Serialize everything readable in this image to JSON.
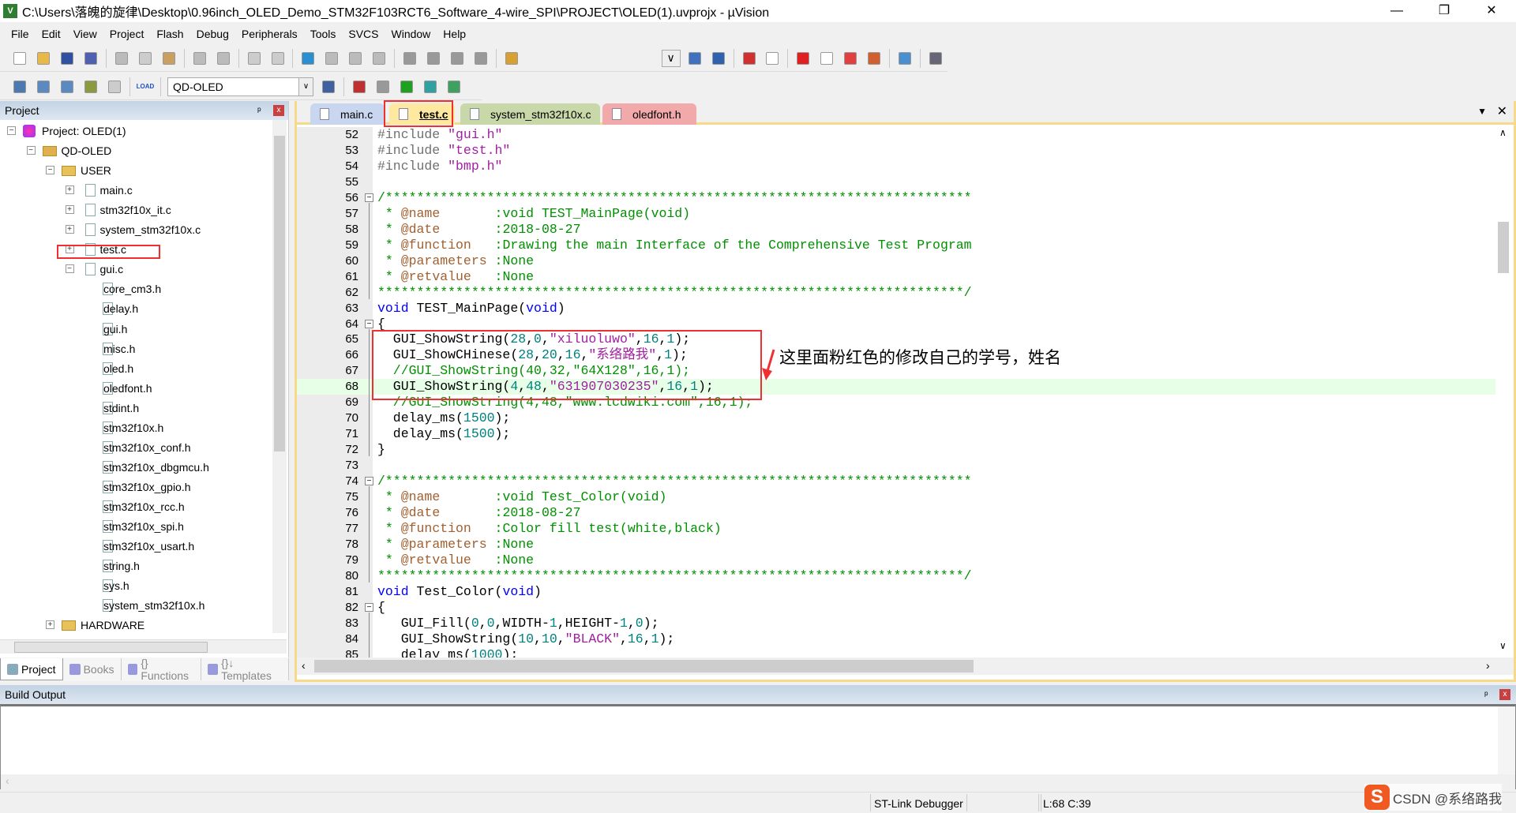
{
  "window": {
    "title": "C:\\Users\\落魄的旋律\\Desktop\\0.96inch_OLED_Demo_STM32F103RCT6_Software_4-wire_SPI\\PROJECT\\OLED(1).uvprojx - µVision",
    "minimize": "—",
    "restore": "❐",
    "close": "✕"
  },
  "menu": [
    "File",
    "Edit",
    "View",
    "Project",
    "Flash",
    "Debug",
    "Peripherals",
    "Tools",
    "SVCS",
    "Window",
    "Help"
  ],
  "toolbar": {
    "target": "QD-OLED",
    "load_label": "LOAD"
  },
  "project_panel": {
    "title": "Project",
    "pin": "ᵖ",
    "close": "x",
    "tree": [
      {
        "label": "Project: OLED(1)",
        "level": 0,
        "type": "project",
        "exp": "−"
      },
      {
        "label": "QD-OLED",
        "level": 1,
        "type": "target",
        "exp": "−"
      },
      {
        "label": "USER",
        "level": 2,
        "type": "folder",
        "exp": "−"
      },
      {
        "label": "main.c",
        "level": 3,
        "type": "file",
        "exp": "+"
      },
      {
        "label": "stm32f10x_it.c",
        "level": 3,
        "type": "file",
        "exp": "+"
      },
      {
        "label": "system_stm32f10x.c",
        "level": 3,
        "type": "file",
        "exp": "+"
      },
      {
        "label": "test.c",
        "level": 3,
        "type": "file",
        "exp": "+"
      },
      {
        "label": "gui.c",
        "level": 3,
        "type": "file",
        "exp": "−"
      },
      {
        "label": "core_cm3.h",
        "level": 4,
        "type": "file"
      },
      {
        "label": "delay.h",
        "level": 4,
        "type": "file"
      },
      {
        "label": "gui.h",
        "level": 4,
        "type": "file"
      },
      {
        "label": "misc.h",
        "level": 4,
        "type": "file"
      },
      {
        "label": "oled.h",
        "level": 4,
        "type": "file"
      },
      {
        "label": "oledfont.h",
        "level": 4,
        "type": "file"
      },
      {
        "label": "stdint.h",
        "level": 4,
        "type": "file"
      },
      {
        "label": "stm32f10x.h",
        "level": 4,
        "type": "file"
      },
      {
        "label": "stm32f10x_conf.h",
        "level": 4,
        "type": "file"
      },
      {
        "label": "stm32f10x_dbgmcu.h",
        "level": 4,
        "type": "file"
      },
      {
        "label": "stm32f10x_gpio.h",
        "level": 4,
        "type": "file"
      },
      {
        "label": "stm32f10x_rcc.h",
        "level": 4,
        "type": "file"
      },
      {
        "label": "stm32f10x_spi.h",
        "level": 4,
        "type": "file"
      },
      {
        "label": "stm32f10x_usart.h",
        "level": 4,
        "type": "file"
      },
      {
        "label": "string.h",
        "level": 4,
        "type": "file"
      },
      {
        "label": "sys.h",
        "level": 4,
        "type": "file"
      },
      {
        "label": "system_stm32f10x.h",
        "level": 4,
        "type": "file"
      },
      {
        "label": "HARDWARE",
        "level": 2,
        "type": "folder",
        "exp": "+"
      }
    ],
    "tabs": [
      {
        "label": "Project",
        "icon": "project-icon",
        "active": true
      },
      {
        "label": "Books",
        "icon": "books-icon"
      },
      {
        "label": "{} Functions",
        "icon": "functions-icon"
      },
      {
        "label": "{}↓ Templates",
        "icon": "templates-icon"
      }
    ]
  },
  "editor": {
    "tabs": [
      {
        "label": "main.c",
        "color": "#c9d6ef"
      },
      {
        "label": "test.c",
        "color": "#ffe9a0",
        "active": true
      },
      {
        "label": "system_stm32f10x.c",
        "color": "#c9d8a8"
      },
      {
        "label": "oledfont.h",
        "color": "#f2a9a9"
      }
    ],
    "current_line": 68,
    "lines": [
      {
        "n": 52,
        "t": [
          [
            "#include ",
            "pp"
          ],
          [
            "\"gui.h\"",
            "str"
          ]
        ]
      },
      {
        "n": 53,
        "t": [
          [
            "#include ",
            "pp"
          ],
          [
            "\"test.h\"",
            "str"
          ]
        ]
      },
      {
        "n": 54,
        "t": [
          [
            "#include ",
            "pp"
          ],
          [
            "\"bmp.h\"",
            "str"
          ]
        ]
      },
      {
        "n": 55,
        "t": []
      },
      {
        "n": 56,
        "f": "−",
        "t": [
          [
            "/***************************************************************************",
            "cm"
          ]
        ]
      },
      {
        "n": 57,
        "t": [
          [
            " * ",
            "cm"
          ],
          [
            "@name       ",
            "tag"
          ],
          [
            ":void TEST_MainPage(void)",
            "cm"
          ]
        ]
      },
      {
        "n": 58,
        "t": [
          [
            " * ",
            "cm"
          ],
          [
            "@date       ",
            "tag"
          ],
          [
            ":2018-08-27",
            "cm"
          ]
        ]
      },
      {
        "n": 59,
        "t": [
          [
            " * ",
            "cm"
          ],
          [
            "@function   ",
            "tag"
          ],
          [
            ":Drawing the main Interface of the Comprehensive Test Program",
            "cm"
          ]
        ]
      },
      {
        "n": 60,
        "t": [
          [
            " * ",
            "cm"
          ],
          [
            "@parameters ",
            "tag"
          ],
          [
            ":None",
            "cm"
          ]
        ]
      },
      {
        "n": 61,
        "t": [
          [
            " * ",
            "cm"
          ],
          [
            "@retvalue   ",
            "tag"
          ],
          [
            ":None",
            "cm"
          ]
        ]
      },
      {
        "n": 62,
        "t": [
          [
            "***************************************************************************/",
            "cm"
          ]
        ]
      },
      {
        "n": 63,
        "t": [
          [
            "void",
            "kw"
          ],
          [
            " TEST_MainPage(",
            "id"
          ],
          [
            "void",
            "kw"
          ],
          [
            ")",
            "id"
          ]
        ]
      },
      {
        "n": 64,
        "f": "−",
        "t": [
          [
            "{",
            "id"
          ]
        ]
      },
      {
        "n": 65,
        "t": [
          [
            "  GUI_ShowString(",
            "id"
          ],
          [
            "28",
            "num"
          ],
          [
            ",",
            "id"
          ],
          [
            "0",
            "num"
          ],
          [
            ",",
            "id"
          ],
          [
            "\"xiluoluwo\"",
            "str"
          ],
          [
            ",",
            "id"
          ],
          [
            "16",
            "num"
          ],
          [
            ",",
            "id"
          ],
          [
            "1",
            "num"
          ],
          [
            ");",
            "id"
          ]
        ]
      },
      {
        "n": 66,
        "t": [
          [
            "  GUI_ShowCHinese(",
            "id"
          ],
          [
            "28",
            "num"
          ],
          [
            ",",
            "id"
          ],
          [
            "20",
            "num"
          ],
          [
            ",",
            "id"
          ],
          [
            "16",
            "num"
          ],
          [
            ",",
            "id"
          ],
          [
            "\"系络路我\"",
            "str"
          ],
          [
            ",",
            "id"
          ],
          [
            "1",
            "num"
          ],
          [
            ");",
            "id"
          ]
        ]
      },
      {
        "n": 67,
        "t": [
          [
            "  //GUI_ShowString(40,32,\"64X128\",16,1);",
            "cm"
          ]
        ]
      },
      {
        "n": 68,
        "t": [
          [
            "  GUI_ShowString(",
            "id"
          ],
          [
            "4",
            "num"
          ],
          [
            ",",
            "id"
          ],
          [
            "48",
            "num"
          ],
          [
            ",",
            "id"
          ],
          [
            "\"631907030235\"",
            "str"
          ],
          [
            ",",
            "id"
          ],
          [
            "16",
            "num"
          ],
          [
            ",",
            "id"
          ],
          [
            "1",
            "num"
          ],
          [
            ");",
            "id"
          ]
        ]
      },
      {
        "n": 69,
        "t": [
          [
            "  //GUI_ShowString(4,48,\"www.lcdwiki.com\",16,1);",
            "cm"
          ]
        ]
      },
      {
        "n": 70,
        "t": [
          [
            "  delay_ms(",
            "id"
          ],
          [
            "1500",
            "num"
          ],
          [
            ");",
            "id"
          ]
        ]
      },
      {
        "n": 71,
        "t": [
          [
            "  delay_ms(",
            "id"
          ],
          [
            "1500",
            "num"
          ],
          [
            ");",
            "id"
          ]
        ]
      },
      {
        "n": 72,
        "t": [
          [
            "}",
            "id"
          ]
        ]
      },
      {
        "n": 73,
        "t": []
      },
      {
        "n": 74,
        "f": "−",
        "t": [
          [
            "/***************************************************************************",
            "cm"
          ]
        ]
      },
      {
        "n": 75,
        "t": [
          [
            " * ",
            "cm"
          ],
          [
            "@name       ",
            "tag"
          ],
          [
            ":void Test_Color(void)",
            "cm"
          ]
        ]
      },
      {
        "n": 76,
        "t": [
          [
            " * ",
            "cm"
          ],
          [
            "@date       ",
            "tag"
          ],
          [
            ":2018-08-27",
            "cm"
          ]
        ]
      },
      {
        "n": 77,
        "t": [
          [
            " * ",
            "cm"
          ],
          [
            "@function   ",
            "tag"
          ],
          [
            ":Color fill test(white,black)",
            "cm"
          ]
        ]
      },
      {
        "n": 78,
        "t": [
          [
            " * ",
            "cm"
          ],
          [
            "@parameters ",
            "tag"
          ],
          [
            ":None",
            "cm"
          ]
        ]
      },
      {
        "n": 79,
        "t": [
          [
            " * ",
            "cm"
          ],
          [
            "@retvalue   ",
            "tag"
          ],
          [
            ":None",
            "cm"
          ]
        ]
      },
      {
        "n": 80,
        "t": [
          [
            "***************************************************************************/",
            "cm"
          ]
        ]
      },
      {
        "n": 81,
        "t": [
          [
            "void",
            "kw"
          ],
          [
            " Test_Color(",
            "id"
          ],
          [
            "void",
            "kw"
          ],
          [
            ")",
            "id"
          ]
        ]
      },
      {
        "n": 82,
        "f": "−",
        "t": [
          [
            "{",
            "id"
          ]
        ]
      },
      {
        "n": 83,
        "t": [
          [
            "   GUI_Fill(",
            "id"
          ],
          [
            "0",
            "num"
          ],
          [
            ",",
            "id"
          ],
          [
            "0",
            "num"
          ],
          [
            ",WIDTH-",
            "id"
          ],
          [
            "1",
            "num"
          ],
          [
            ",HEIGHT-",
            "id"
          ],
          [
            "1",
            "num"
          ],
          [
            ",",
            "id"
          ],
          [
            "0",
            "num"
          ],
          [
            ");",
            "id"
          ]
        ]
      },
      {
        "n": 84,
        "t": [
          [
            "   GUI_ShowString(",
            "id"
          ],
          [
            "10",
            "num"
          ],
          [
            ",",
            "id"
          ],
          [
            "10",
            "num"
          ],
          [
            ",",
            "id"
          ],
          [
            "\"BLACK\"",
            "str"
          ],
          [
            ",",
            "id"
          ],
          [
            "16",
            "num"
          ],
          [
            ",",
            "id"
          ],
          [
            "1",
            "num"
          ],
          [
            ");",
            "id"
          ]
        ]
      },
      {
        "n": 85,
        "t": [
          [
            "   delay_ms(",
            "id"
          ],
          [
            "1000",
            "num"
          ],
          [
            ");",
            "id"
          ]
        ]
      }
    ]
  },
  "annotation": "这里面粉红色的修改自己的学号，姓名",
  "build_output": {
    "title": "Build Output",
    "pin": "ᵖ",
    "close": "x"
  },
  "status": {
    "debugger": "ST-Link Debugger",
    "position": "L:68 C:39"
  },
  "watermark": {
    "logo": "S",
    "text": "CSDN @系络路我"
  },
  "colors": {
    "highlight_box": "#f03030",
    "current_line": "#e6ffe6",
    "editor_frame": "#f7d98a"
  }
}
